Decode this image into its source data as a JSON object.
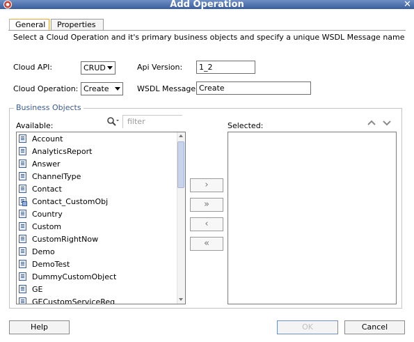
{
  "window": {
    "title": "Add Operation"
  },
  "tabs": [
    {
      "label": "General",
      "active": true
    },
    {
      "label": "Properties",
      "active": false
    }
  ],
  "description": "Select a Cloud Operation and it's primary business objects and specify a unique WSDL Message name",
  "cloud_api": {
    "label": "Cloud API:",
    "value": "CRUD"
  },
  "api_version": {
    "label": "Api Version:",
    "value": "1_2"
  },
  "cloud_operation": {
    "label": "Cloud Operation:",
    "value": "Create"
  },
  "wsdl_message": {
    "label": "WSDL Message:",
    "value": "Create"
  },
  "business_objects": {
    "title": "Business Objects",
    "filter_placeholder": "filter",
    "available_label": "Available:",
    "selected_label": "Selected:",
    "available": [
      {
        "label": "Account",
        "icon": "document-icon"
      },
      {
        "label": "AnalyticsReport",
        "icon": "document-icon"
      },
      {
        "label": "Answer",
        "icon": "document-icon"
      },
      {
        "label": "ChannelType",
        "icon": "document-icon"
      },
      {
        "label": "Contact",
        "icon": "document-icon"
      },
      {
        "label": "Contact_CustomObj",
        "icon": "custom-object-icon"
      },
      {
        "label": "Country",
        "icon": "document-icon"
      },
      {
        "label": "Custom",
        "icon": "document-icon"
      },
      {
        "label": "CustomRightNow",
        "icon": "document-icon"
      },
      {
        "label": "Demo",
        "icon": "document-icon"
      },
      {
        "label": "DemoTest",
        "icon": "document-icon"
      },
      {
        "label": "DummyCustomObject",
        "icon": "document-icon"
      },
      {
        "label": "GE",
        "icon": "document-icon"
      },
      {
        "label": "GECustomServiceReq",
        "icon": "document-icon"
      }
    ],
    "selected": [],
    "move_buttons": {
      "add": "›",
      "add_all": "»",
      "remove": "‹",
      "remove_all": "«"
    }
  },
  "buttons": {
    "help": "Help",
    "ok": "OK",
    "cancel": "Cancel"
  },
  "colors": {
    "title_bar": "#4a6ba8",
    "group_title": "#3b5a8c",
    "active_tab_border": "#e7a93a"
  }
}
